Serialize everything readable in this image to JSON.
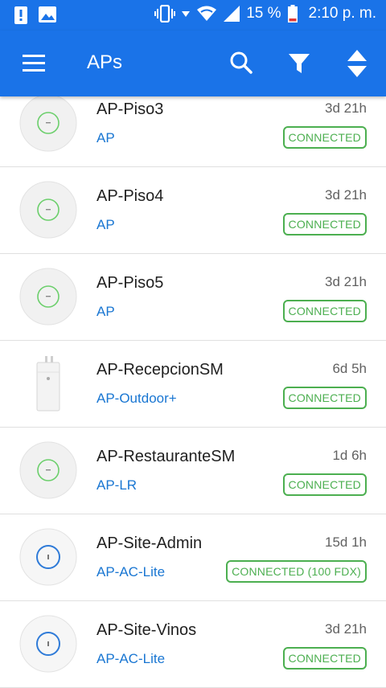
{
  "status_bar": {
    "battery_percent": "15 %",
    "time": "2:10 p. m."
  },
  "app_bar": {
    "title": "APs"
  },
  "devices": [
    {
      "name": "AP-Piso3",
      "model": "AP",
      "uptime": "3d 21h",
      "status": "CONNECTED",
      "icon": "uap-icon"
    },
    {
      "name": "AP-Piso4",
      "model": "AP",
      "uptime": "3d 21h",
      "status": "CONNECTED",
      "icon": "uap-icon"
    },
    {
      "name": "AP-Piso5",
      "model": "AP",
      "uptime": "3d 21h",
      "status": "CONNECTED",
      "icon": "uap-icon"
    },
    {
      "name": "AP-RecepcionSM",
      "model": "AP-Outdoor+",
      "uptime": "6d 5h",
      "status": "CONNECTED",
      "icon": "outdoor-ap-icon"
    },
    {
      "name": "AP-RestauranteSM",
      "model": "AP-LR",
      "uptime": "1d 6h",
      "status": "CONNECTED",
      "icon": "uap-icon"
    },
    {
      "name": "AP-Site-Admin",
      "model": "AP-AC-Lite",
      "uptime": "15d 1h",
      "status": "CONNECTED (100 FDX)",
      "icon": "uap-ac-icon"
    },
    {
      "name": "AP-Site-Vinos",
      "model": "AP-AC-Lite",
      "uptime": "3d 21h",
      "status": "CONNECTED",
      "icon": "uap-ac-icon"
    }
  ],
  "colors": {
    "primary": "#1a73e8",
    "status_connected": "#4caf50",
    "model_link": "#1976d2"
  }
}
